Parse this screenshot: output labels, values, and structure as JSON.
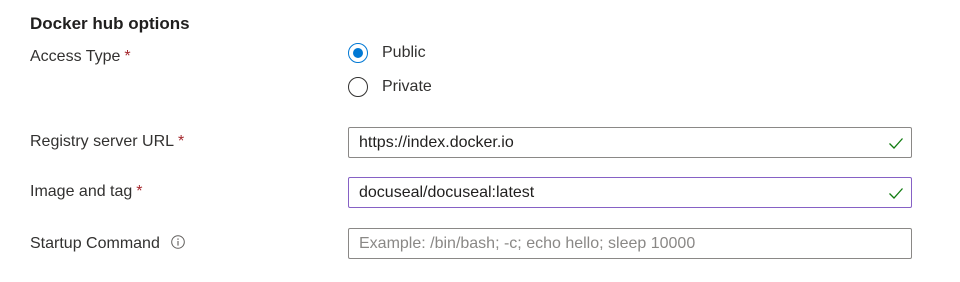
{
  "section": {
    "title": "Docker hub options"
  },
  "access_type": {
    "label": "Access Type",
    "required_mark": "*",
    "options": [
      {
        "label": "Public",
        "selected": true
      },
      {
        "label": "Private",
        "selected": false
      }
    ]
  },
  "registry_server_url": {
    "label": "Registry server URL",
    "required_mark": "*",
    "value": "https://index.docker.io",
    "valid": true
  },
  "image_and_tag": {
    "label": "Image and tag",
    "required_mark": "*",
    "value": "docuseal/docuseal:latest",
    "valid": true
  },
  "startup_command": {
    "label": "Startup Command",
    "value": "",
    "placeholder": "Example: /bin/bash; -c; echo hello; sleep 10000"
  },
  "colors": {
    "accent": "#0078d4",
    "required": "#a4262c",
    "valid_check": "#107c10",
    "focus_border": "#8661c5",
    "input_border": "#8a8886"
  },
  "icons": {
    "info": "info-icon",
    "valid": "checkmark-icon"
  }
}
